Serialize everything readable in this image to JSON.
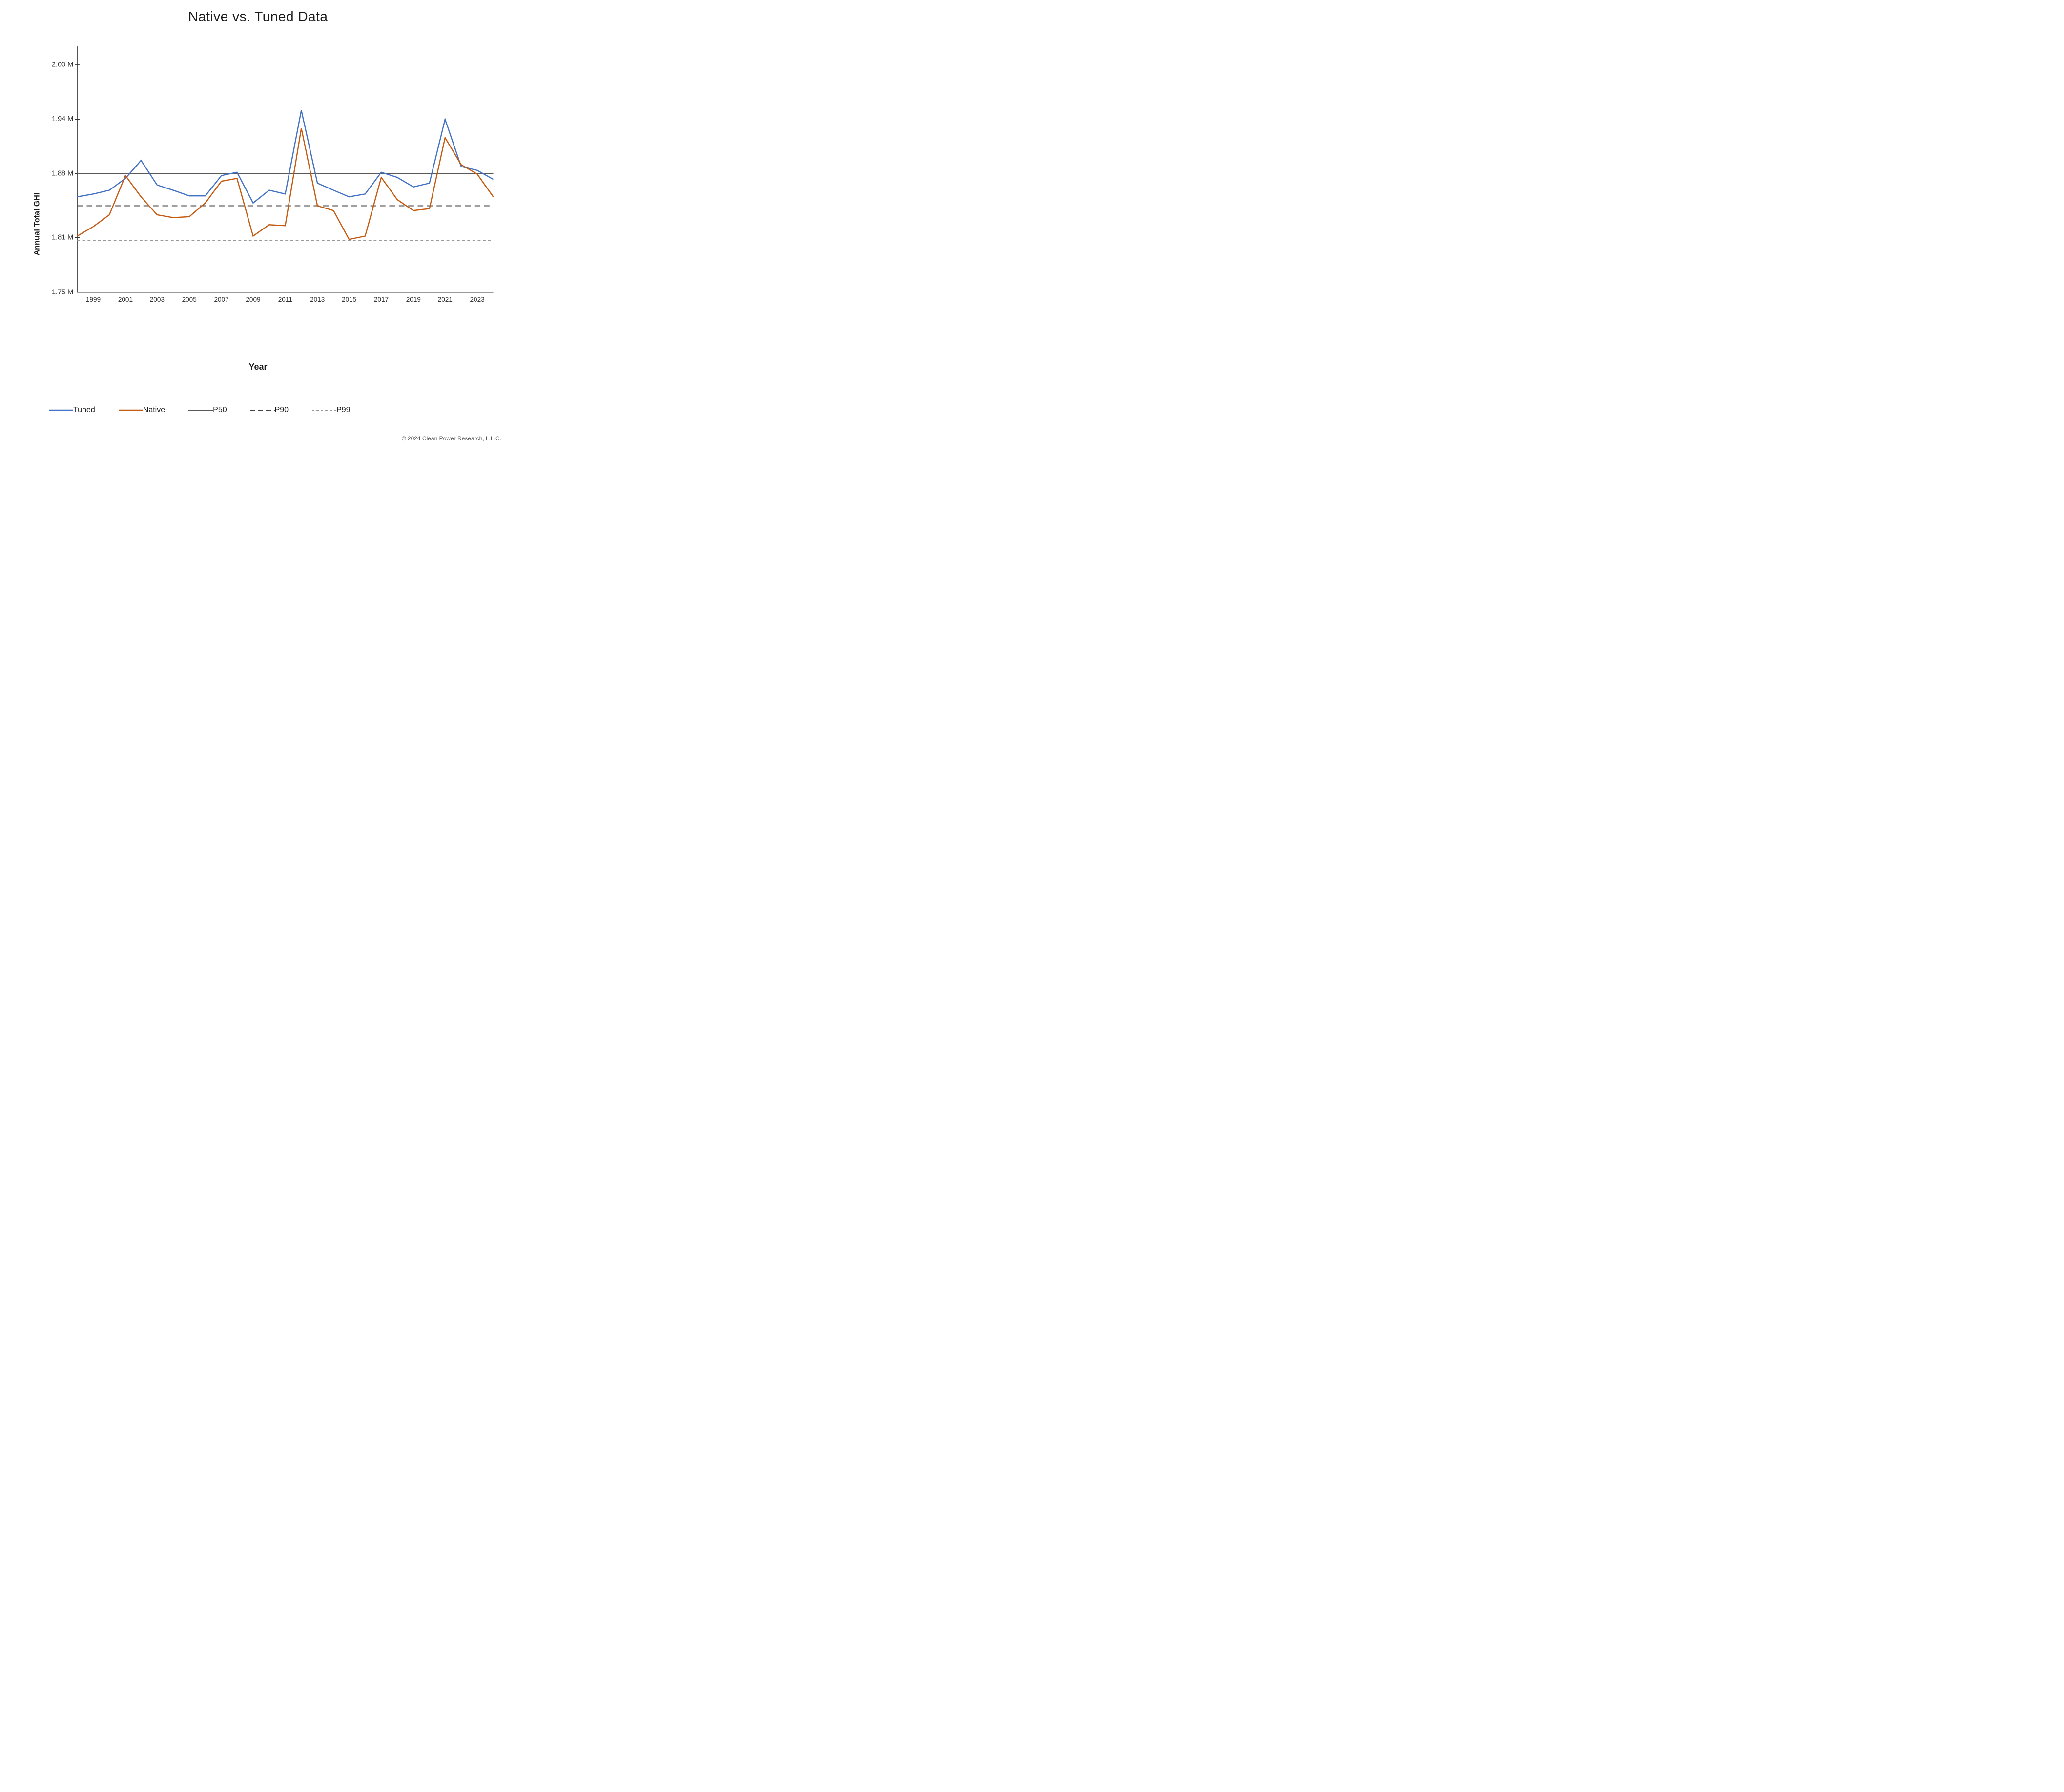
{
  "title": "Native vs. Tuned Data",
  "y_axis_label": "Annual Total GHI",
  "x_axis_label": "Year",
  "copyright": "© 2024 Clean Power Research, L.L.C.",
  "y_ticks": [
    "2.00 M",
    "1.94 M",
    "1.88 M",
    "1.81 M",
    "1.75 M"
  ],
  "x_ticks": [
    "1999",
    "2001",
    "2003",
    "2005",
    "2007",
    "2009",
    "2011",
    "2013",
    "2015",
    "2017",
    "2019",
    "2021",
    "2023"
  ],
  "legend": [
    {
      "label": "Tuned",
      "color": "#4472C4",
      "style": "solid"
    },
    {
      "label": "Native",
      "color": "#C55A11",
      "style": "solid"
    },
    {
      "label": "P50",
      "color": "#595959",
      "style": "solid"
    },
    {
      "label": "P90",
      "color": "#404040",
      "style": "dashed"
    },
    {
      "label": "P99",
      "color": "#999999",
      "style": "dashed-light"
    }
  ],
  "chart": {
    "y_min": 1.75,
    "y_max": 2.02,
    "p50": 1.88,
    "p90": 1.845,
    "p99": 1.807,
    "tuned_data": [
      {
        "year": 1998,
        "value": 1.855
      },
      {
        "year": 1999,
        "value": 1.858
      },
      {
        "year": 2000,
        "value": 1.862
      },
      {
        "year": 2001,
        "value": 1.875
      },
      {
        "year": 2002,
        "value": 1.895
      },
      {
        "year": 2003,
        "value": 1.868
      },
      {
        "year": 2004,
        "value": 1.862
      },
      {
        "year": 2005,
        "value": 1.856
      },
      {
        "year": 2006,
        "value": 1.856
      },
      {
        "year": 2007,
        "value": 1.878
      },
      {
        "year": 2008,
        "value": 1.882
      },
      {
        "year": 2009,
        "value": 1.848
      },
      {
        "year": 2010,
        "value": 1.862
      },
      {
        "year": 2011,
        "value": 1.858
      },
      {
        "year": 2012,
        "value": 1.95
      },
      {
        "year": 2013,
        "value": 1.87
      },
      {
        "year": 2014,
        "value": 1.862
      },
      {
        "year": 2015,
        "value": 1.855
      },
      {
        "year": 2016,
        "value": 1.858
      },
      {
        "year": 2017,
        "value": 1.882
      },
      {
        "year": 2018,
        "value": 1.876
      },
      {
        "year": 2019,
        "value": 1.866
      },
      {
        "year": 2020,
        "value": 1.87
      },
      {
        "year": 2021,
        "value": 1.94
      },
      {
        "year": 2022,
        "value": 1.888
      },
      {
        "year": 2023,
        "value": 1.884
      },
      {
        "year": 2024,
        "value": 1.874
      }
    ],
    "native_data": [
      {
        "year": 1998,
        "value": 1.812
      },
      {
        "year": 1999,
        "value": 1.822
      },
      {
        "year": 2000,
        "value": 1.835
      },
      {
        "year": 2001,
        "value": 1.878
      },
      {
        "year": 2002,
        "value": 1.855
      },
      {
        "year": 2003,
        "value": 1.835
      },
      {
        "year": 2004,
        "value": 1.832
      },
      {
        "year": 2005,
        "value": 1.833
      },
      {
        "year": 2006,
        "value": 1.848
      },
      {
        "year": 2007,
        "value": 1.872
      },
      {
        "year": 2008,
        "value": 1.875
      },
      {
        "year": 2009,
        "value": 1.812
      },
      {
        "year": 2010,
        "value": 1.824
      },
      {
        "year": 2011,
        "value": 1.823
      },
      {
        "year": 2012,
        "value": 1.93
      },
      {
        "year": 2013,
        "value": 1.845
      },
      {
        "year": 2014,
        "value": 1.84
      },
      {
        "year": 2015,
        "value": 1.808
      },
      {
        "year": 2016,
        "value": 1.812
      },
      {
        "year": 2017,
        "value": 1.876
      },
      {
        "year": 2018,
        "value": 1.852
      },
      {
        "year": 2019,
        "value": 1.84
      },
      {
        "year": 2020,
        "value": 1.842
      },
      {
        "year": 2021,
        "value": 1.92
      },
      {
        "year": 2022,
        "value": 1.89
      },
      {
        "year": 2023,
        "value": 1.88
      },
      {
        "year": 2024,
        "value": 1.855
      }
    ]
  }
}
